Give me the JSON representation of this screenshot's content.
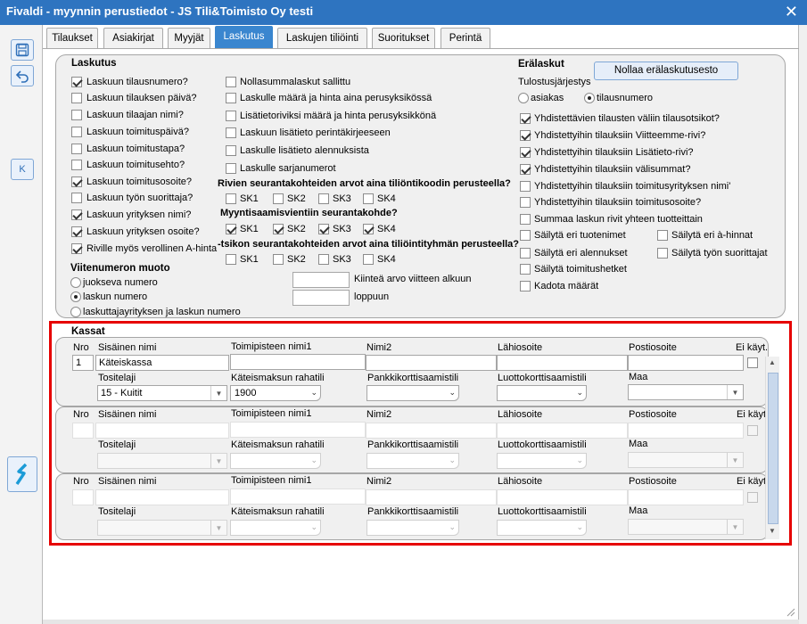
{
  "window": {
    "title": "Fivaldi - myynnin perustiedot - JS Tili&Toimisto Oy testi",
    "close_glyph": "✕"
  },
  "toolbar": {
    "k_label": "K"
  },
  "tabs": [
    "Tilaukset",
    "Asiakirjat",
    "Myyjät",
    "Laskutus",
    "Laskujen tiliöinti",
    "Suoritukset",
    "Perintä"
  ],
  "laskutus": {
    "title": "Laskutus",
    "col1": [
      {
        "label": "Laskuun tilausnumero?",
        "checked": true
      },
      {
        "label": "Laskuun tilauksen päivä?",
        "checked": false
      },
      {
        "label": "Laskuun tilaajan nimi?",
        "checked": false
      },
      {
        "label": "Laskuun toimituspäivä?",
        "checked": false
      },
      {
        "label": "Laskuun toimitustapa?",
        "checked": false
      },
      {
        "label": "Laskuun toimitusehto?",
        "checked": false
      },
      {
        "label": "Laskuun toimitusosoite?",
        "checked": true
      },
      {
        "label": "Laskuun työn suorittaja?",
        "checked": false
      },
      {
        "label": "Laskuun yrityksen nimi?",
        "checked": true
      },
      {
        "label": "Laskuun yrityksen osoite?",
        "checked": true
      },
      {
        "label": "Riville myös verollinen A-hinta",
        "checked": true
      }
    ],
    "col2": [
      {
        "label": "Nollasummalaskut sallittu",
        "checked": false
      },
      {
        "label": "Laskulle määrä ja hinta aina perusyksikössä",
        "checked": false
      },
      {
        "label": "Lisätietoriviksi määrä ja hinta perusyksikkönä",
        "checked": false
      },
      {
        "label": "Laskuun lisätieto perintäkirjeeseen",
        "checked": false
      },
      {
        "label": "Laskulle lisätieto alennuksista",
        "checked": false
      },
      {
        "label": "Laskulle sarjanumerot",
        "checked": false
      }
    ],
    "sk_group1_label": "Rivien seurantakohteiden arvot aina tiliöntikoodin perusteella?",
    "sk_group1": [
      {
        "label": "SK1",
        "checked": false
      },
      {
        "label": "SK2",
        "checked": false
      },
      {
        "label": "SK3",
        "checked": false
      },
      {
        "label": "SK4",
        "checked": false
      }
    ],
    "sk_group2_label": "Myyntisaamisvientiin seurantakohde?",
    "sk_group2": [
      {
        "label": "SK1",
        "checked": true
      },
      {
        "label": "SK2",
        "checked": true
      },
      {
        "label": "SK3",
        "checked": true
      },
      {
        "label": "SK4",
        "checked": true
      }
    ],
    "sk_group3_label": "-tsikon seurantakohteiden arvot aina tiliöintityhmän  perusteella?",
    "sk_group3": [
      {
        "label": "SK1",
        "checked": false
      },
      {
        "label": "SK2",
        "checked": false
      },
      {
        "label": "SK3",
        "checked": false
      },
      {
        "label": "SK4",
        "checked": false
      }
    ],
    "viite_title": "Viitenumeron muoto",
    "viite_options": [
      {
        "label": "juokseva numero",
        "selected": false
      },
      {
        "label": "laskun numero",
        "selected": true
      },
      {
        "label": "laskuttajayrityksen ja laskun numero",
        "selected": false
      }
    ],
    "kiintea_label": "Kiinteä arvo viitteen alkuun",
    "kiintea_value": "",
    "loppuun_label": "loppuun",
    "loppuun_value": ""
  },
  "eralaskut": {
    "title": "Erälaskut",
    "reset_button": "Nollaa erälaskutusesto",
    "order_label": "Tulostusjärjestys",
    "order_options": [
      {
        "label": "asiakas",
        "selected": false
      },
      {
        "label": "tilausnumero",
        "selected": true
      }
    ],
    "checks": [
      {
        "label": "Yhdistettävien tilausten väliin tilausotsikot?",
        "checked": true
      },
      {
        "label": "Yhdistettyihin tilauksiin Viitteemme-rivi?",
        "checked": true
      },
      {
        "label": "Yhdistettyihin tilauksiin Lisätieto-rivi?",
        "checked": true
      },
      {
        "label": "Yhdistettyihin tilauksiin välisummat?",
        "checked": true
      },
      {
        "label": "Yhdistettyihin tilauksiin toimitusyrityksen nimi'",
        "checked": false
      },
      {
        "label": "Yhdistettyihin tilauksiin toimitusosoite?",
        "checked": false
      },
      {
        "label": "Summaa laskun rivit yhteen tuotteittain",
        "checked": false
      },
      {
        "label": "Säilytä eri tuotenimet",
        "checked": false
      },
      {
        "label": "Säilytä eri alennukset",
        "checked": false
      },
      {
        "label": "Säilytä toimitushetket",
        "checked": false
      },
      {
        "label": "Kadota määrät",
        "checked": false
      }
    ],
    "checks_right": [
      {
        "label": "Säilytä eri à-hinnat",
        "checked": false
      },
      {
        "label": "Säilytä työn suorittajat",
        "checked": false
      }
    ]
  },
  "kassat": {
    "title": "Kassat",
    "headers": {
      "nro": "Nro",
      "sis_nimi": "Sisäinen nimi",
      "toimipiste": "Toimipisteen nimi1",
      "nimi2": "Nimi2",
      "lahiosoite": "Lähiosoite",
      "postiosoite": "Postiosoite",
      "ei_kayt": "Ei käyt.",
      "ei_kayt_short": "Ei käyt",
      "tositelaji": "Tositelaji",
      "kateis_rahatili": "Käteismaksun rahatili",
      "pankkikortti": "Pankkikorttisaamistili",
      "luottokortti": "Luottokorttisaamistili",
      "maa": "Maa"
    },
    "rows": [
      {
        "nro": "1",
        "sis_nimi": "Käteiskassa",
        "toimipiste": "",
        "nimi2": "",
        "lahiosoite": "",
        "postiosoite": "",
        "ei_kayt": false,
        "tositelaji": "15 - Kuitit",
        "kateis_rahatili": "1900",
        "pankkikortti": "",
        "luottokortti": "",
        "maa": ""
      },
      {
        "nro": "",
        "sis_nimi": "",
        "toimipiste": "",
        "nimi2": "",
        "lahiosoite": "",
        "postiosoite": "",
        "ei_kayt": false,
        "tositelaji": "",
        "kateis_rahatili": "",
        "pankkikortti": "",
        "luottokortti": "",
        "maa": ""
      },
      {
        "nro": "",
        "sis_nimi": "",
        "toimipiste": "",
        "nimi2": "",
        "lahiosoite": "",
        "postiosoite": "",
        "ei_kayt": false,
        "tositelaji": "",
        "kateis_rahatili": "",
        "pankkikortti": "",
        "luottokortti": "",
        "maa": ""
      }
    ]
  },
  "colors": {
    "titlebar": "#2e74c0",
    "active_tab": "#3a86cf",
    "highlight_border": "#e60000"
  }
}
